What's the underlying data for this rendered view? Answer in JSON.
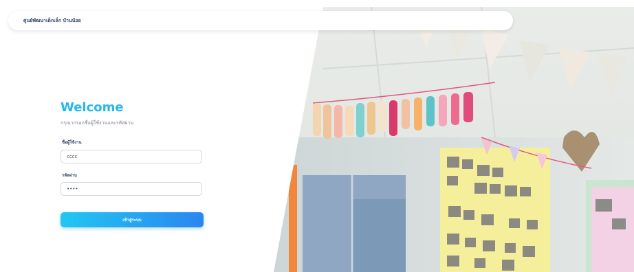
{
  "navbar": {
    "brand": "ศูนย์พัฒนาเด็กเล็ก บ้านน้อย"
  },
  "login": {
    "title": "Welcome",
    "subtitle": "กรุณากรอกชื่อผู้ใช้งานและรหัสผ่าน",
    "username_label": "ชื่อผู้ใช้งาน",
    "username_value": "cccc",
    "password_label": "รหัสผ่าน",
    "password_value": "••••",
    "submit_label": "เข้าสู่ระบบ"
  },
  "colors": {
    "accent": "#26b8e8",
    "button_start": "#21c7f2",
    "button_end": "#2b86f0",
    "heading_text": "#344767"
  }
}
